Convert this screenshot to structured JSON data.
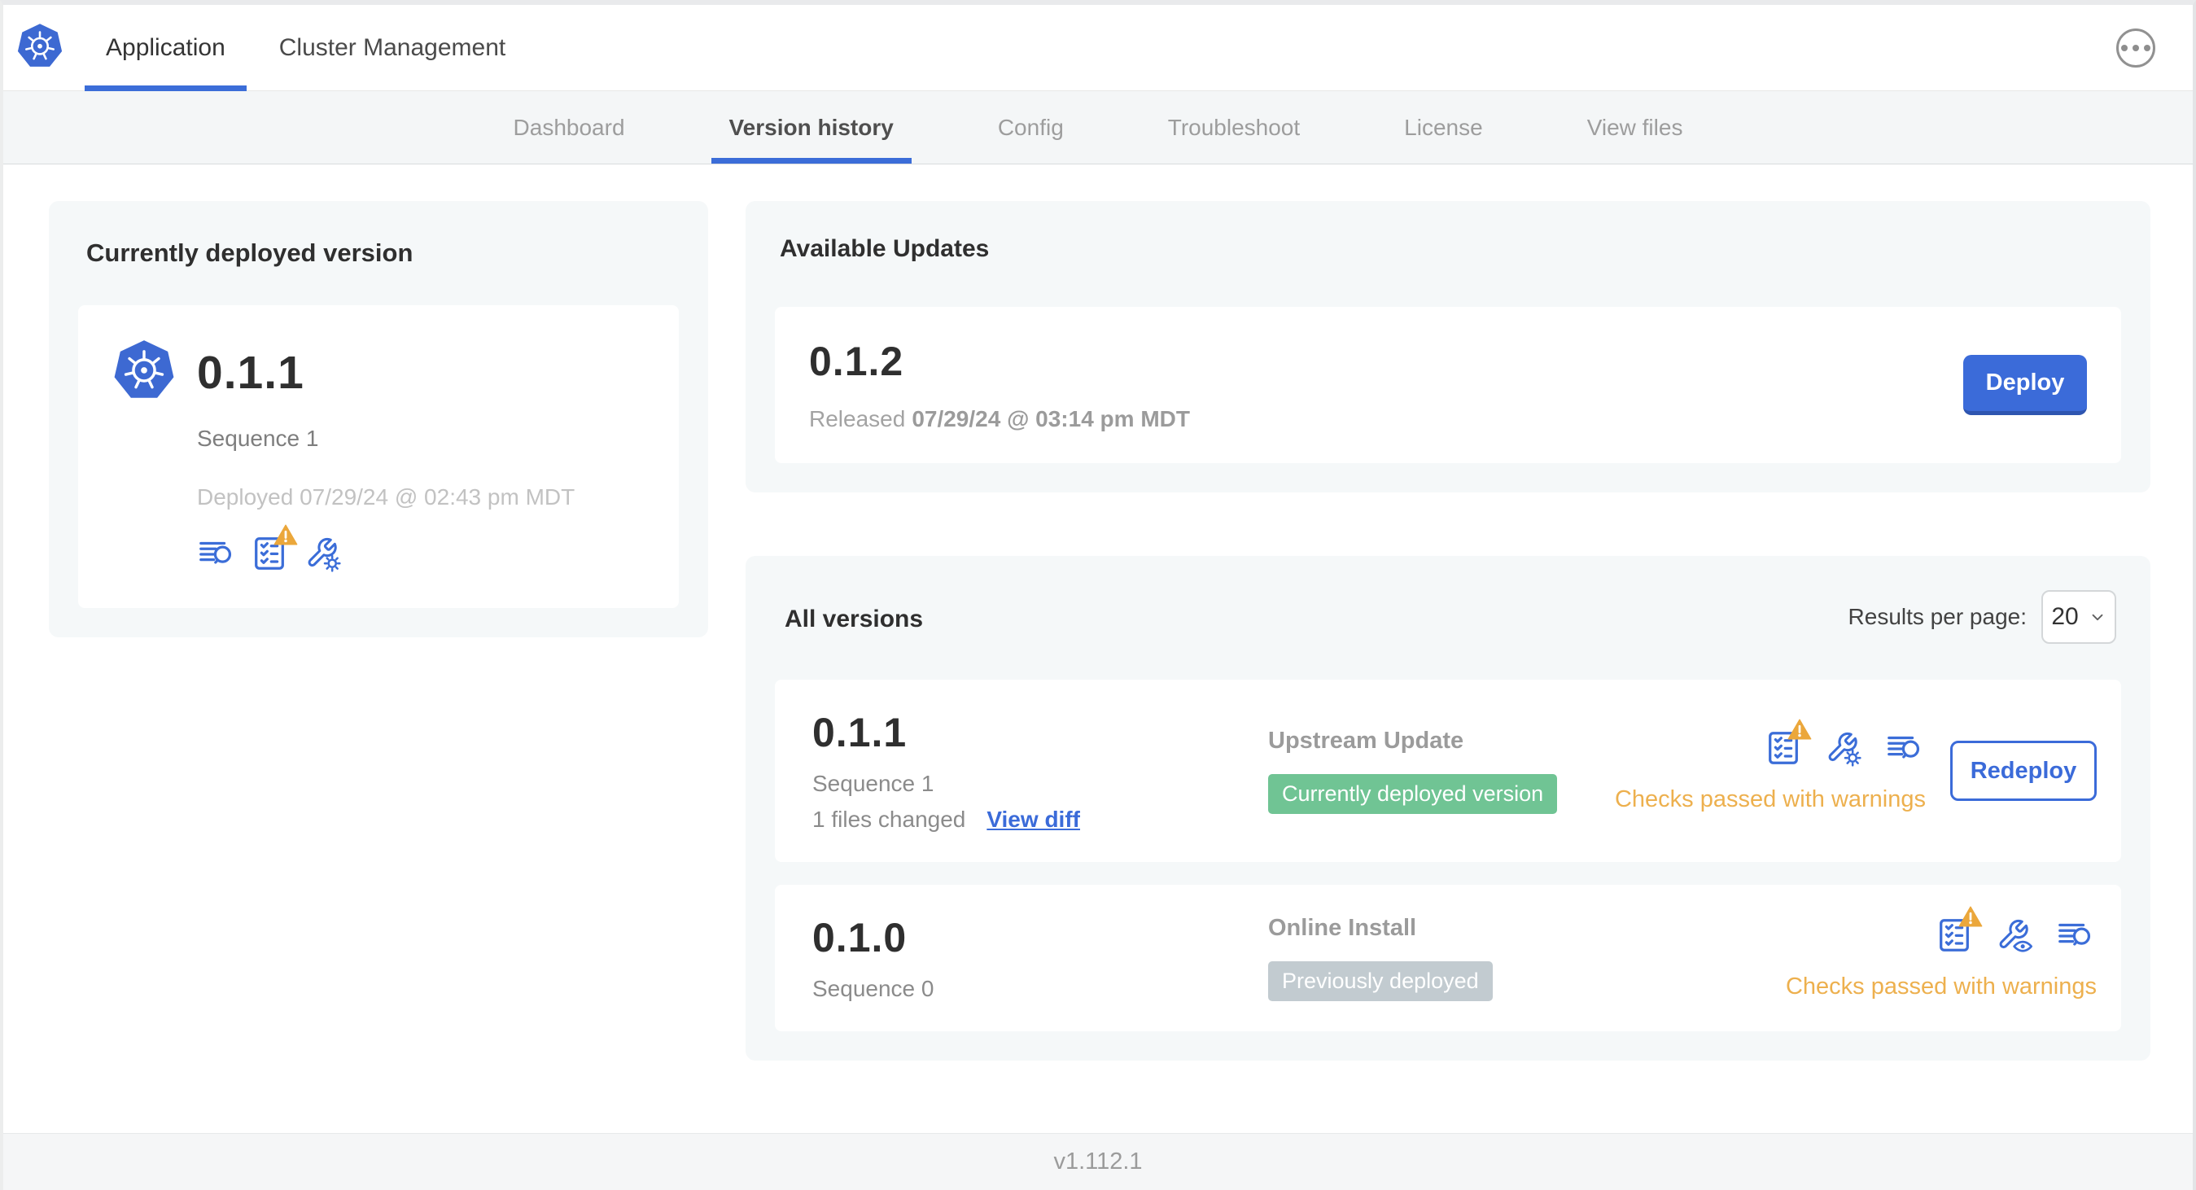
{
  "topbar": {
    "tabs": [
      {
        "label": "Application",
        "active": true
      },
      {
        "label": "Cluster Management",
        "active": false
      }
    ]
  },
  "subnav": {
    "tabs": [
      {
        "label": "Dashboard",
        "active": false
      },
      {
        "label": "Version history",
        "active": true
      },
      {
        "label": "Config",
        "active": false
      },
      {
        "label": "Troubleshoot",
        "active": false
      },
      {
        "label": "License",
        "active": false
      },
      {
        "label": "View files",
        "active": false
      }
    ]
  },
  "currently_deployed": {
    "title": "Currently deployed version",
    "version": "0.1.1",
    "sequence": "Sequence 1",
    "deployed_text": "Deployed 07/29/24 @ 02:43 pm MDT"
  },
  "available_updates": {
    "title": "Available Updates",
    "version": "0.1.2",
    "released_prefix": "Released",
    "released_date": "07/29/24 @ 03:14 pm MDT",
    "deploy_label": "Deploy"
  },
  "all_versions": {
    "title": "All versions",
    "results_per_page_label": "Results per page:",
    "results_per_page_value": "20",
    "rows": [
      {
        "version": "0.1.1",
        "sequence": "Sequence 1",
        "files_changed": "1 files changed",
        "view_diff_label": "View diff",
        "source": "Upstream Update",
        "status_badge": "Currently deployed version",
        "badge_type": "green",
        "checks_text": "Checks passed with warnings",
        "action_label": "Redeploy"
      },
      {
        "version": "0.1.0",
        "sequence": "Sequence 0",
        "source": "Online Install",
        "status_badge": "Previously deployed",
        "badge_type": "gray",
        "checks_text": "Checks passed with warnings"
      }
    ]
  },
  "footer": {
    "version_label": "v1.112.1"
  },
  "icons": [
    "kubernetes-logo-icon",
    "ellipsis-more-icon",
    "release-notes-icon",
    "preflight-checks-icon",
    "warning-triangle-icon",
    "edit-config-wrench-gear-icon",
    "view-config-wrench-eye-icon",
    "chevron-down-icon"
  ],
  "colors": {
    "primary_blue": "#3B6DD8",
    "k8s_logo_blue": "#3D69D2",
    "badge_green": "#70C494",
    "badge_gray": "#C2CBD0",
    "warning_text_orange": "#EDB04E",
    "warning_triangle_orange": "#EBA73B",
    "card_gray": "#F5F8F9"
  }
}
